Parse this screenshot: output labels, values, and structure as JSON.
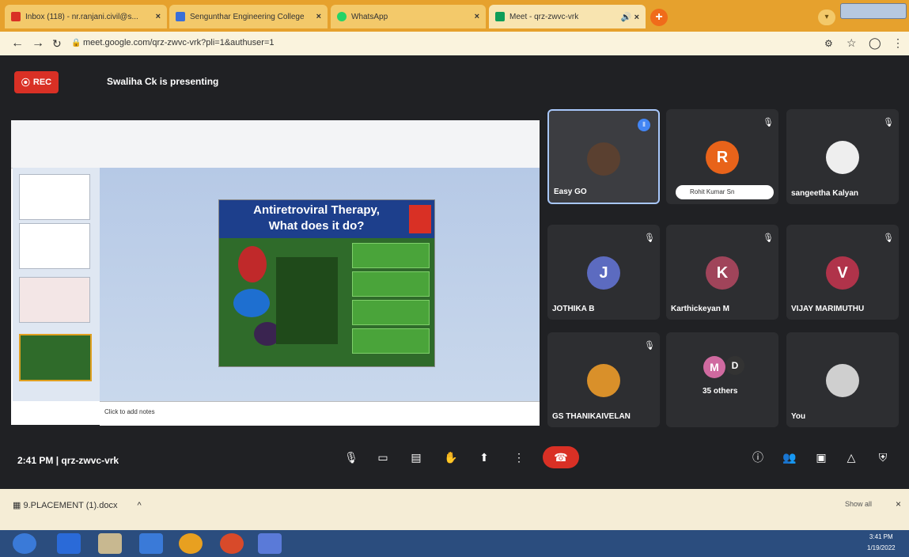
{
  "browser": {
    "tabs": [
      {
        "label": "Inbox (118) - nr.ranjani.civil@s...",
        "favicon_color": "#d93025"
      },
      {
        "label": "Sengunthar Engineering College",
        "favicon_color": "#3a6fd8"
      },
      {
        "label": "WhatsApp",
        "favicon_color": "#25d366"
      },
      {
        "label": "Meet - qrz-zwvc-vrk",
        "favicon_color": "#0f9d58"
      }
    ],
    "new_tab_label": "+",
    "url": "meet.google.com/qrz-zwvc-vrk?pli=1&authuser=1"
  },
  "meet": {
    "rec_label": "REC",
    "presenting_label": "Swaliha Ck is presenting",
    "slide": {
      "title_line1": "Antiretroviral Therapy,",
      "title_line2": "What does it do?",
      "notes_placeholder": "Click to add notes"
    },
    "participants": [
      {
        "name": "Easy GO",
        "initial": "",
        "avatar_color": "#5a4030",
        "highlighted": true
      },
      {
        "name": "Rohit Kumar Sn",
        "initial": "R",
        "avatar_color": "#e8631a",
        "highlighted": false
      },
      {
        "name": "sangeetha Kalyan",
        "initial": "",
        "avatar_color": "#eee",
        "highlighted": false
      },
      {
        "name": "JOTHIKA B",
        "initial": "J",
        "avatar_color": "#5c6bc0",
        "highlighted": false
      },
      {
        "name": "Karthickeyan M",
        "initial": "K",
        "avatar_color": "#a0445a",
        "highlighted": false
      },
      {
        "name": "VIJAY MARIMUTHU",
        "initial": "V",
        "avatar_color": "#b0334a",
        "highlighted": false
      },
      {
        "name": "GS THANIKAIVELAN",
        "initial": "",
        "avatar_color": "#d9902a",
        "highlighted": false
      },
      {
        "name": "35 others",
        "initial": "M",
        "avatar_color": "#d06aa0",
        "highlighted": false
      },
      {
        "name": "You",
        "initial": "",
        "avatar_color": "#cfcfcf",
        "highlighted": false
      }
    ],
    "meeting_time": "2:41 PM",
    "meeting_code": "qrz-zwvc-vrk",
    "others_initial2": "D"
  },
  "downloads": {
    "file_name": "9.PLACEMENT (1).docx",
    "show_all": "Show all"
  },
  "taskbar": {
    "time": "3:41 PM",
    "date": "1/19/2022"
  }
}
